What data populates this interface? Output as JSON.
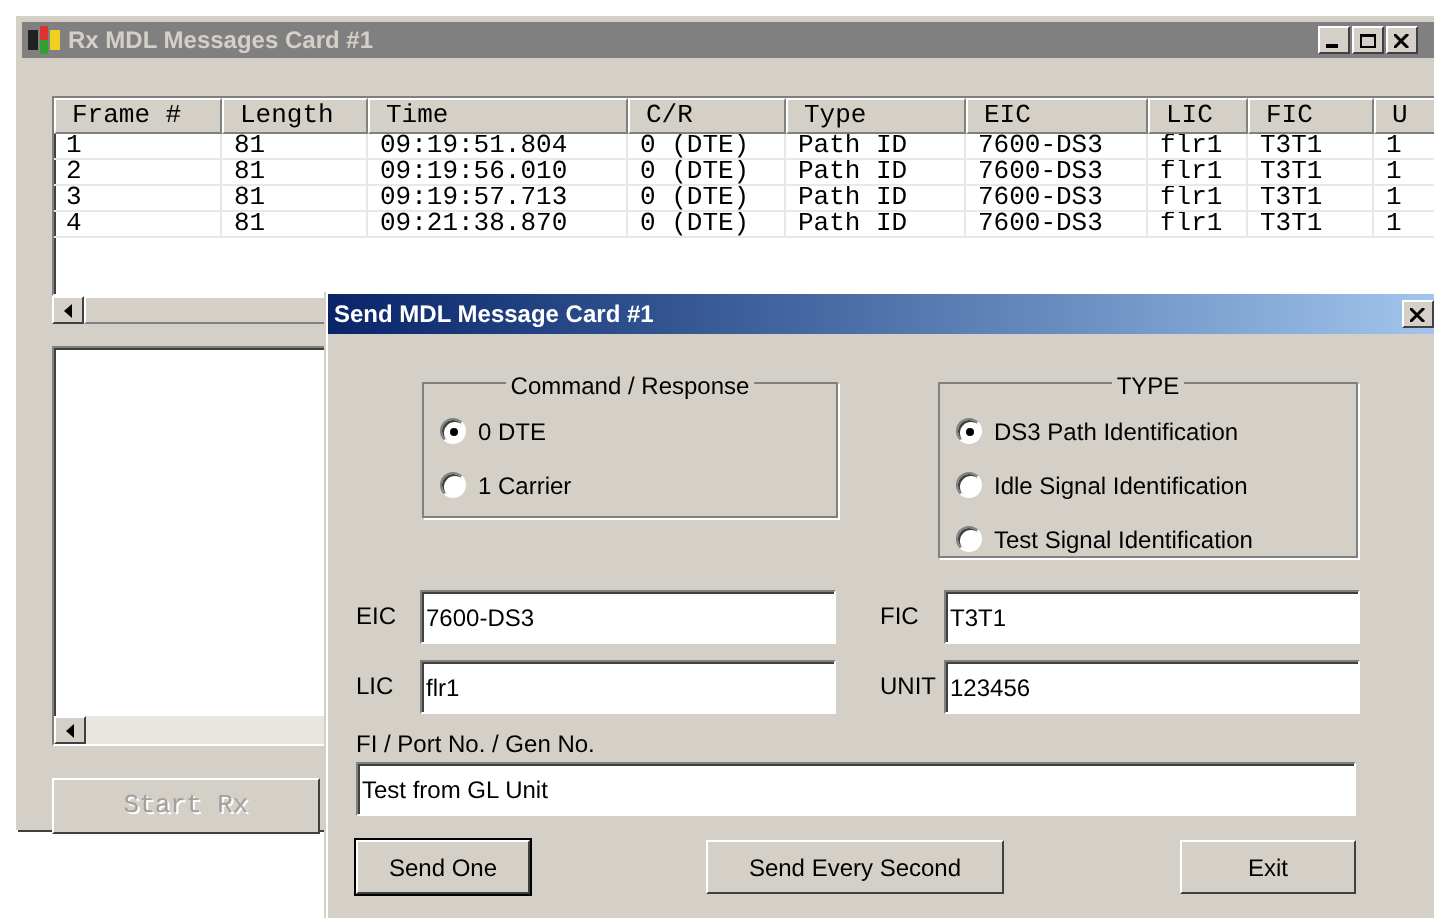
{
  "main_window": {
    "title": "Rx MDL Messages Card #1",
    "active": false,
    "table": {
      "columns": [
        "Frame #",
        "Length",
        "Time",
        "C/R",
        "Type",
        "EIC",
        "LIC",
        "FIC",
        "U"
      ],
      "rows": [
        [
          "1",
          "81",
          "09:19:51.804",
          "0 (DTE)",
          "Path ID",
          "7600-DS3",
          "flr1",
          "T3T1",
          "1"
        ],
        [
          "2",
          "81",
          "09:19:56.010",
          "0 (DTE)",
          "Path ID",
          "7600-DS3",
          "flr1",
          "T3T1",
          "1"
        ],
        [
          "3",
          "81",
          "09:19:57.713",
          "0 (DTE)",
          "Path ID",
          "7600-DS3",
          "flr1",
          "T3T1",
          "1"
        ],
        [
          "4",
          "81",
          "09:21:38.870",
          "0 (DTE)",
          "Path ID",
          "7600-DS3",
          "flr1",
          "T3T1",
          "1"
        ]
      ]
    },
    "start_button": {
      "label": "Start Rx",
      "disabled": true
    }
  },
  "dialog": {
    "title": "Send MDL Message Card #1",
    "active": true,
    "command_response": {
      "title": "Command / Response",
      "options": [
        {
          "label": "0 DTE",
          "selected": true
        },
        {
          "label": "1 Carrier",
          "selected": false
        }
      ]
    },
    "type": {
      "title": "TYPE",
      "options": [
        {
          "label": "DS3 Path Identification",
          "selected": true
        },
        {
          "label": "Idle Signal Identification",
          "selected": false
        },
        {
          "label": "Test Signal Identification",
          "selected": false
        }
      ]
    },
    "fields": [
      {
        "label": "EIC",
        "value": "7600-DS3"
      },
      {
        "label": "FIC",
        "value": "T3T1"
      },
      {
        "label": "LIC",
        "value": "flr1"
      },
      {
        "label": "UNIT",
        "value": "123456"
      }
    ],
    "fi_field": {
      "label": "FI / Port No. / Gen No.",
      "value": "Test from GL Unit"
    },
    "buttons": [
      {
        "label": "Send One",
        "default": true
      },
      {
        "label": "Send Every Second",
        "default": false
      },
      {
        "label": "Exit",
        "default": false
      }
    ]
  }
}
